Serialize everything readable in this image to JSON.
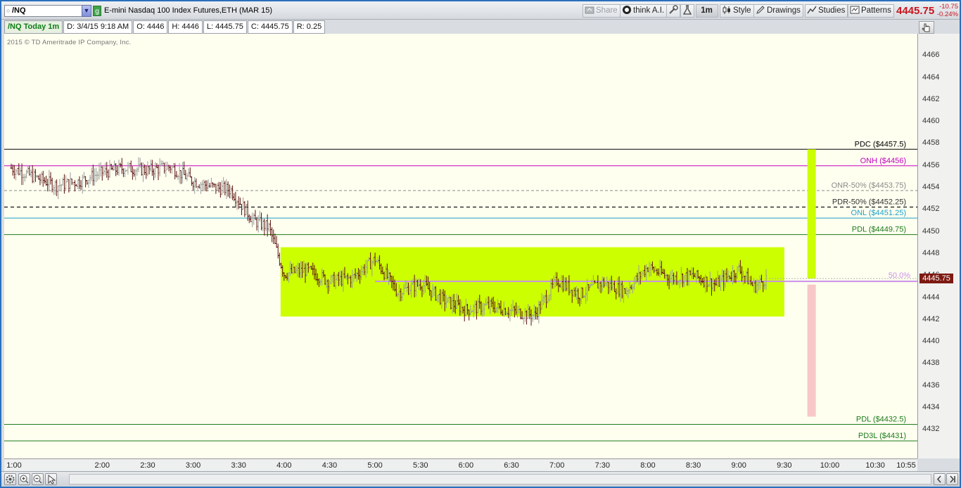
{
  "toolbar": {
    "symbol": "/NQ",
    "symbol_dot": "○",
    "dropdown_glyph": "▼",
    "group_badge": "g",
    "instrument": "E-mini Nasdaq 100 Index Futures,ETH (MAR 15)",
    "share_label": "Share",
    "think_ai_label": "think A.I.",
    "timeframe_label": "1m",
    "style_label": "Style",
    "drawings_label": "Drawings",
    "studies_label": "Studies",
    "patterns_label": "Patterns",
    "last_price": "4445.75",
    "change_abs": "-10.75",
    "change_pct": "-0.24%"
  },
  "info": {
    "study": "/NQ Today 1m",
    "date": "D: 3/4/15 9:18 AM",
    "open": "O: 4446",
    "high": "H: 4446",
    "low": "L: 4445.75",
    "close": "C: 4445.75",
    "range": "R: 0.25"
  },
  "copyright": "2015 © TD Ameritrade IP Company, Inc.",
  "price_axis": {
    "ticks": [
      "4466",
      "4464",
      "4462",
      "4460",
      "4458",
      "4456",
      "4454",
      "4452",
      "4450",
      "4448",
      "4446",
      "4444",
      "4442",
      "4440",
      "4438",
      "4436",
      "4434",
      "4432"
    ],
    "last_price_tag": "4445.75"
  },
  "time_axis": {
    "ticks": [
      "1:00",
      "2:00",
      "2:30",
      "3:00",
      "3:30",
      "4:00",
      "4:30",
      "5:00",
      "5:30",
      "6:00",
      "6:30",
      "7:00",
      "7:30",
      "8:00",
      "8:30",
      "9:00",
      "9:30",
      "10:00",
      "10:30",
      "10:55"
    ]
  },
  "levels": [
    {
      "label": "PDC ($4457.5)",
      "price": 4457.5,
      "color": "#000000",
      "style": "solid"
    },
    {
      "label": "ONH ($4456)",
      "price": 4456,
      "color": "#c000c0",
      "style": "solid"
    },
    {
      "label": "ONR-50% ($4453.75)",
      "price": 4453.75,
      "color": "#8a8a8a",
      "style": "dashed"
    },
    {
      "label": "PDR-50% ($4452.25)",
      "price": 4452.25,
      "color": "#333333",
      "style": "dashed"
    },
    {
      "label": "ONL ($4451.25)",
      "price": 4451.25,
      "color": "#1f9fc8",
      "style": "solid"
    },
    {
      "label": "PDL ($4449.75)",
      "price": 4449.75,
      "color": "#1a7a1a",
      "style": "solid"
    },
    {
      "label": "PDL ($4432.5)",
      "price": 4432.5,
      "color": "#1a7a1a",
      "style": "solid"
    },
    {
      "label": "PD3L ($4431)",
      "price": 4431,
      "color": "#1a7a1a",
      "style": "solid"
    }
  ],
  "fib_label": "50.0%",
  "colors": {
    "chart_bg": "#fffff0",
    "range_box": "#ccff00",
    "up_bar": "#9b9b9b",
    "down_bar": "#5a1010",
    "bull_target": "#ccff00",
    "bear_target": "#f8c8c8",
    "fib_line": "#c890e8",
    "last_price": "#c8141e"
  },
  "chart_data": {
    "type": "candlestick",
    "symbol": "/NQ",
    "interval": "1m",
    "ylim": [
      4429.4,
      4468
    ],
    "y_ticks": [
      4432,
      4434,
      4436,
      4438,
      4440,
      4442,
      4444,
      4446,
      4448,
      4450,
      4452,
      4454,
      4456,
      4458,
      4460,
      4462,
      4464,
      4466
    ],
    "x_ticks": [
      "1:00",
      "2:00",
      "2:30",
      "3:00",
      "3:30",
      "4:00",
      "4:30",
      "5:00",
      "5:30",
      "6:00",
      "6:30",
      "7:00",
      "7:30",
      "8:00",
      "8:30",
      "9:00",
      "9:30",
      "10:00",
      "10:30",
      "10:55"
    ],
    "price_path": [
      [
        "1:00",
        4455.8
      ],
      [
        "1:15",
        4455.0
      ],
      [
        "1:30",
        4454.2
      ],
      [
        "1:45",
        4454.6
      ],
      [
        "2:00",
        4455.4
      ],
      [
        "2:15",
        4455.8
      ],
      [
        "2:30",
        4455.6
      ],
      [
        "2:45",
        4455.9
      ],
      [
        "3:00",
        4454.6
      ],
      [
        "3:15",
        4454.0
      ],
      [
        "3:25",
        4453.8
      ],
      [
        "3:30",
        4452.8
      ],
      [
        "3:40",
        4451.0
      ],
      [
        "3:50",
        4450.4
      ],
      [
        "4:00",
        4446.2
      ],
      [
        "4:15",
        4446.5
      ],
      [
        "4:30",
        4445.5
      ],
      [
        "4:45",
        4445.8
      ],
      [
        "5:00",
        4447.5
      ],
      [
        "5:15",
        4444.5
      ],
      [
        "5:30",
        4445.3
      ],
      [
        "5:45",
        4443.8
      ],
      [
        "6:00",
        4442.9
      ],
      [
        "6:15",
        4443.3
      ],
      [
        "6:30",
        4442.8
      ],
      [
        "6:45",
        4442.4
      ],
      [
        "7:00",
        4445.6
      ],
      [
        "7:15",
        4444.3
      ],
      [
        "7:30",
        4445.4
      ],
      [
        "7:45",
        4444.6
      ],
      [
        "8:00",
        4446.8
      ],
      [
        "8:15",
        4445.8
      ],
      [
        "8:30",
        4446.0
      ],
      [
        "8:45",
        4445.2
      ],
      [
        "9:00",
        4446.6
      ],
      [
        "9:10",
        4445.0
      ],
      [
        "9:18",
        4445.75
      ]
    ],
    "session_high": 4456.2,
    "session_low": 4441.6,
    "last": 4445.75,
    "range_box": {
      "start": "4:00",
      "end": "9:30",
      "high": 4448.6,
      "low": 4442.3
    },
    "fib_50": {
      "label": "50.0%",
      "price": 4445.5,
      "start": "5:00"
    },
    "projection_up": {
      "time": "9:48",
      "from": 4445.75,
      "to": 4457.5
    },
    "projection_down": {
      "time": "9:48",
      "from": 4445.2,
      "to": 4433.2
    }
  }
}
